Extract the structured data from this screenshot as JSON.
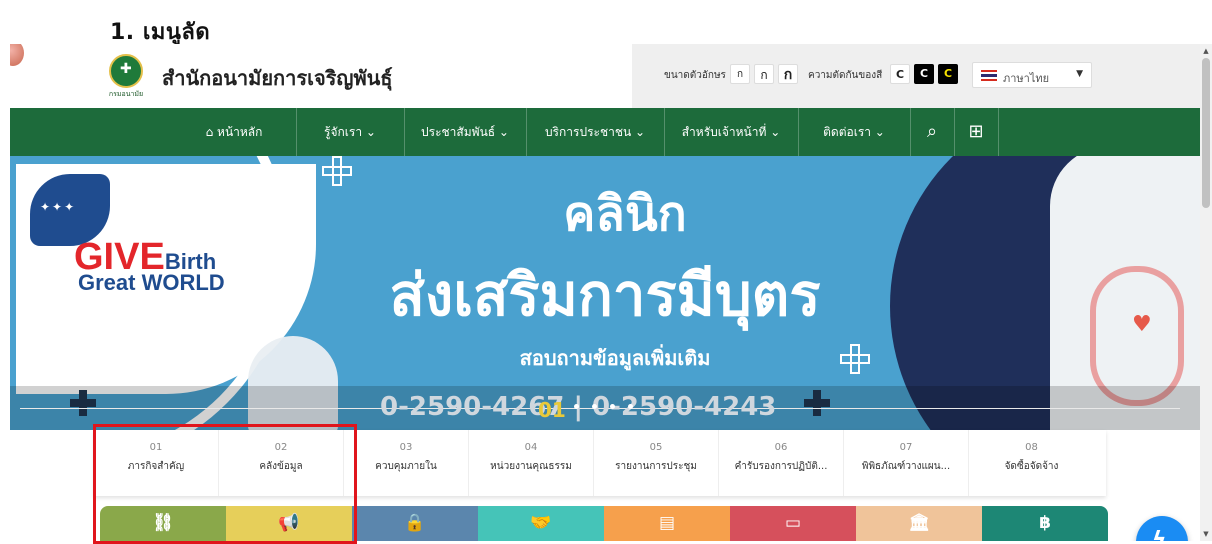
{
  "document_heading": "1. เมนูลัด",
  "header": {
    "org_name": "สำนักอนามัยการเจริญพันธุ์",
    "logo_caption": "กรมอนามัย",
    "font_size_label": "ขนาดตัวอักษร",
    "font_size_buttons": [
      "ก",
      "ก",
      "ก"
    ],
    "contrast_label": "ความตัดกันของสี",
    "contrast_buttons": [
      "C",
      "C",
      "C"
    ],
    "language": "ภาษาไทย"
  },
  "nav": {
    "items": [
      "หน้าหลัก",
      "รู้จักเรา ⌄",
      "ประชาสัมพันธ์ ⌄",
      "บริการประชาชน ⌄",
      "สำหรับเจ้าหน้าที่ ⌄",
      "ติดต่อเรา ⌄"
    ],
    "home_icon": "home-icon",
    "search_icon": "search-icon",
    "sitemap_icon": "sitemap-icon"
  },
  "banner": {
    "logo_line1_red": "GIVE",
    "logo_line1_blue": "Birth",
    "logo_line2": "Great WORLD",
    "title_line1": "คลินิก",
    "title_line2": "ส่งเสริมการมีบุตร",
    "subtitle": "สอบถามข้อมูลเพิ่มเติม",
    "phone": "0-2590-4267 | 0-2590-4243",
    "slide_number": "01"
  },
  "tabs": [
    {
      "num": "01",
      "label": "ภารกิจสำคัญ"
    },
    {
      "num": "02",
      "label": "คลังข้อมูล"
    },
    {
      "num": "03",
      "label": "ควบคุมภายใน"
    },
    {
      "num": "04",
      "label": "หน่วยงานคุณธรรม"
    },
    {
      "num": "05",
      "label": "รายงานการประชุม"
    },
    {
      "num": "06",
      "label": "คำรับรองการปฏิบัติ..."
    },
    {
      "num": "07",
      "label": "พิพิธภัณฑ์วางแผน..."
    },
    {
      "num": "08",
      "label": "จัดซื้อจัดจ้าง"
    }
  ],
  "tiles": [
    {
      "icon": "link-icon",
      "glyph": "⛓",
      "color": "#8aa84a"
    },
    {
      "icon": "megaphone-icon",
      "glyph": "📢",
      "color": "#e6cf5a"
    },
    {
      "icon": "lock-icon",
      "glyph": "🔒",
      "color": "#5b86ad"
    },
    {
      "icon": "handshake-icon",
      "glyph": "🤝",
      "color": "#45c4b8"
    },
    {
      "icon": "pdf-icon",
      "glyph": "▤",
      "color": "#f6a04c"
    },
    {
      "icon": "laptop-icon",
      "glyph": "▭",
      "color": "#d6505c"
    },
    {
      "icon": "museum-icon",
      "glyph": "🏛",
      "color": "#f0c49a"
    },
    {
      "icon": "bitcoin-icon",
      "glyph": "฿",
      "color": "#1d8775"
    }
  ],
  "colors": {
    "nav_green": "#1d6b3b",
    "banner_blue": "#4aa1cf",
    "highlight_red": "#e0151c",
    "messenger_blue": "#1a8cf3"
  }
}
